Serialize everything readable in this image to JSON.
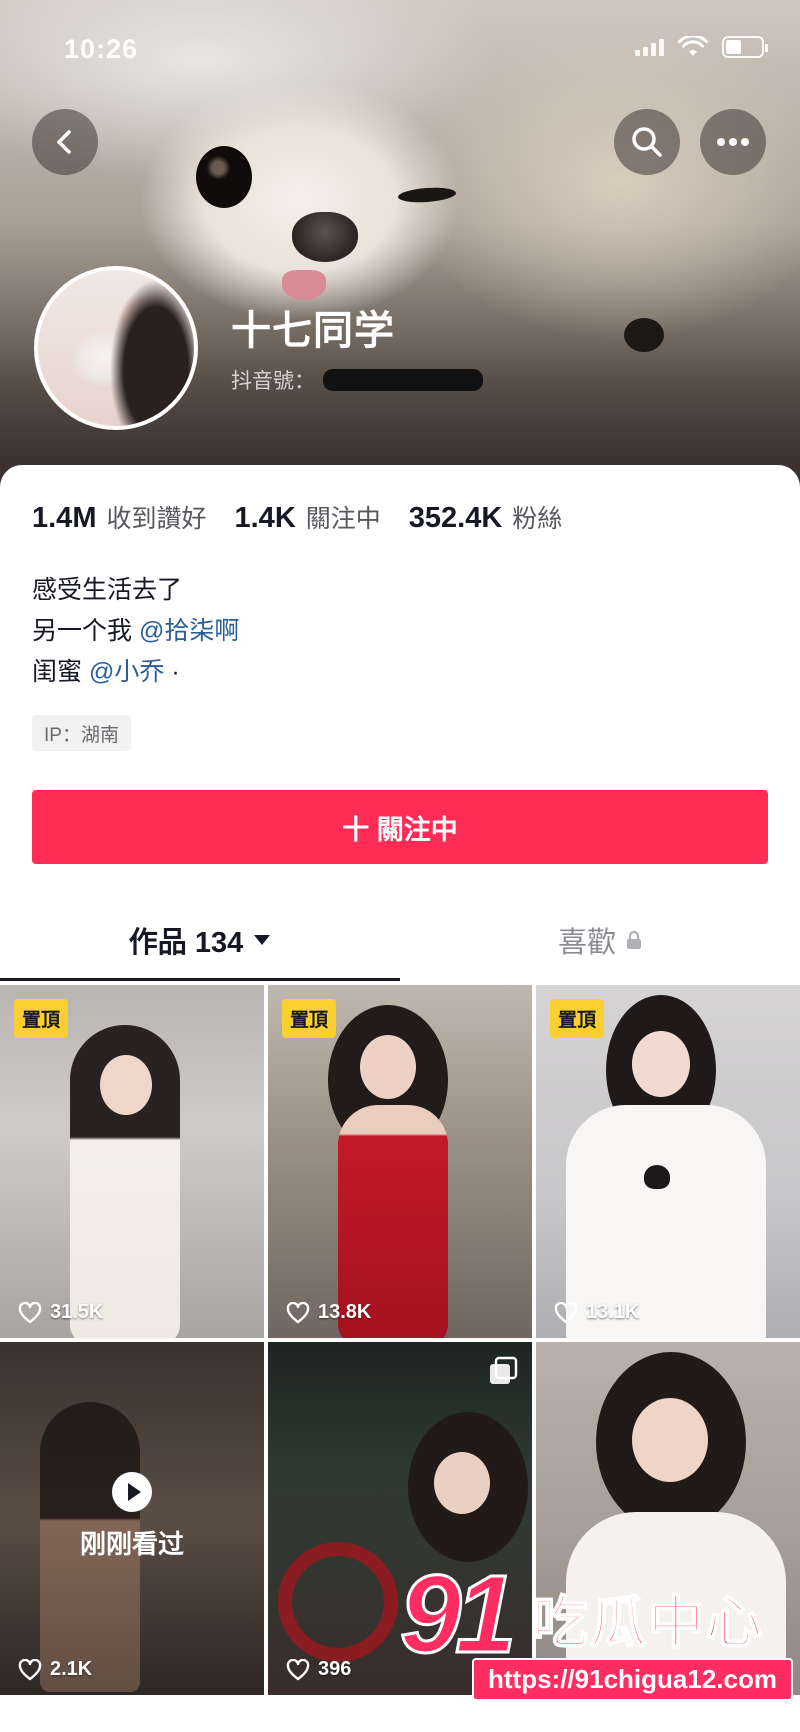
{
  "status_bar": {
    "time": "10:26"
  },
  "profile": {
    "nickname": "十七同学",
    "douyin_id_label": "抖音號："
  },
  "stats": [
    {
      "value": "1.4M",
      "label": "收到讚好"
    },
    {
      "value": "1.4K",
      "label": "關注中"
    },
    {
      "value": "352.4K",
      "label": "粉絲"
    }
  ],
  "bio": {
    "line1": "感受生活去了",
    "line2_prefix": "另一个我",
    "line2_mention": "@拾柒啊",
    "line3_prefix": "闺蜜",
    "line3_mention": "@小乔",
    "line3_suffix": " ·"
  },
  "ip_tag": "IP：湖南",
  "follow_button": {
    "label": "十 關注中"
  },
  "tabs": {
    "works_label": "作品 134",
    "likes_label": "喜歡"
  },
  "grid": [
    {
      "pinned": true,
      "pin_label": "置頂",
      "likes": "31.5K"
    },
    {
      "pinned": true,
      "pin_label": "置頂",
      "likes": "13.8K"
    },
    {
      "pinned": true,
      "pin_label": "置頂",
      "likes": "13.1K"
    },
    {
      "pinned": false,
      "watched_label": "刚刚看过",
      "likes": "2.1K"
    },
    {
      "pinned": false,
      "likes": "396",
      "icon": "multi-image-icon"
    },
    {
      "pinned": false,
      "likes": ""
    }
  ],
  "watermark": {
    "logo": "91",
    "name": "吃瓜中心",
    "url": "https://91chigua12.com"
  },
  "colors": {
    "accent": "#fe2c55",
    "pin_badge": "#fbcf2f",
    "mention": "#2b5e9a",
    "text_primary": "#161823"
  }
}
